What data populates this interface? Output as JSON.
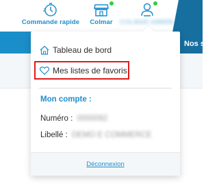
{
  "header": {
    "nav": [
      {
        "label": "Commande rapide",
        "icon": "stopwatch-icon"
      },
      {
        "label": "Colmar",
        "icon": "store-icon"
      },
      {
        "label": "COLMAR AMBRE",
        "icon": "user-icon"
      }
    ],
    "band_text": "Nos s"
  },
  "dropdown": {
    "items": [
      {
        "label": "Tableau de bord",
        "icon": "home-icon"
      },
      {
        "label": "Mes listes de favoris",
        "icon": "heart-icon"
      }
    ],
    "account_title": "Mon compte :",
    "account": {
      "number_label": "Numéro :",
      "number_value": "0000092",
      "label_label": "Libellé :",
      "label_value": "DEMO E COMMERCE"
    },
    "logout": "Déconnexion"
  },
  "colors": {
    "brand_blue": "#1f8ecc",
    "band_blue": "#1a8ec9",
    "highlight_red": "#e01a1a",
    "status_green": "#2ecc40"
  }
}
